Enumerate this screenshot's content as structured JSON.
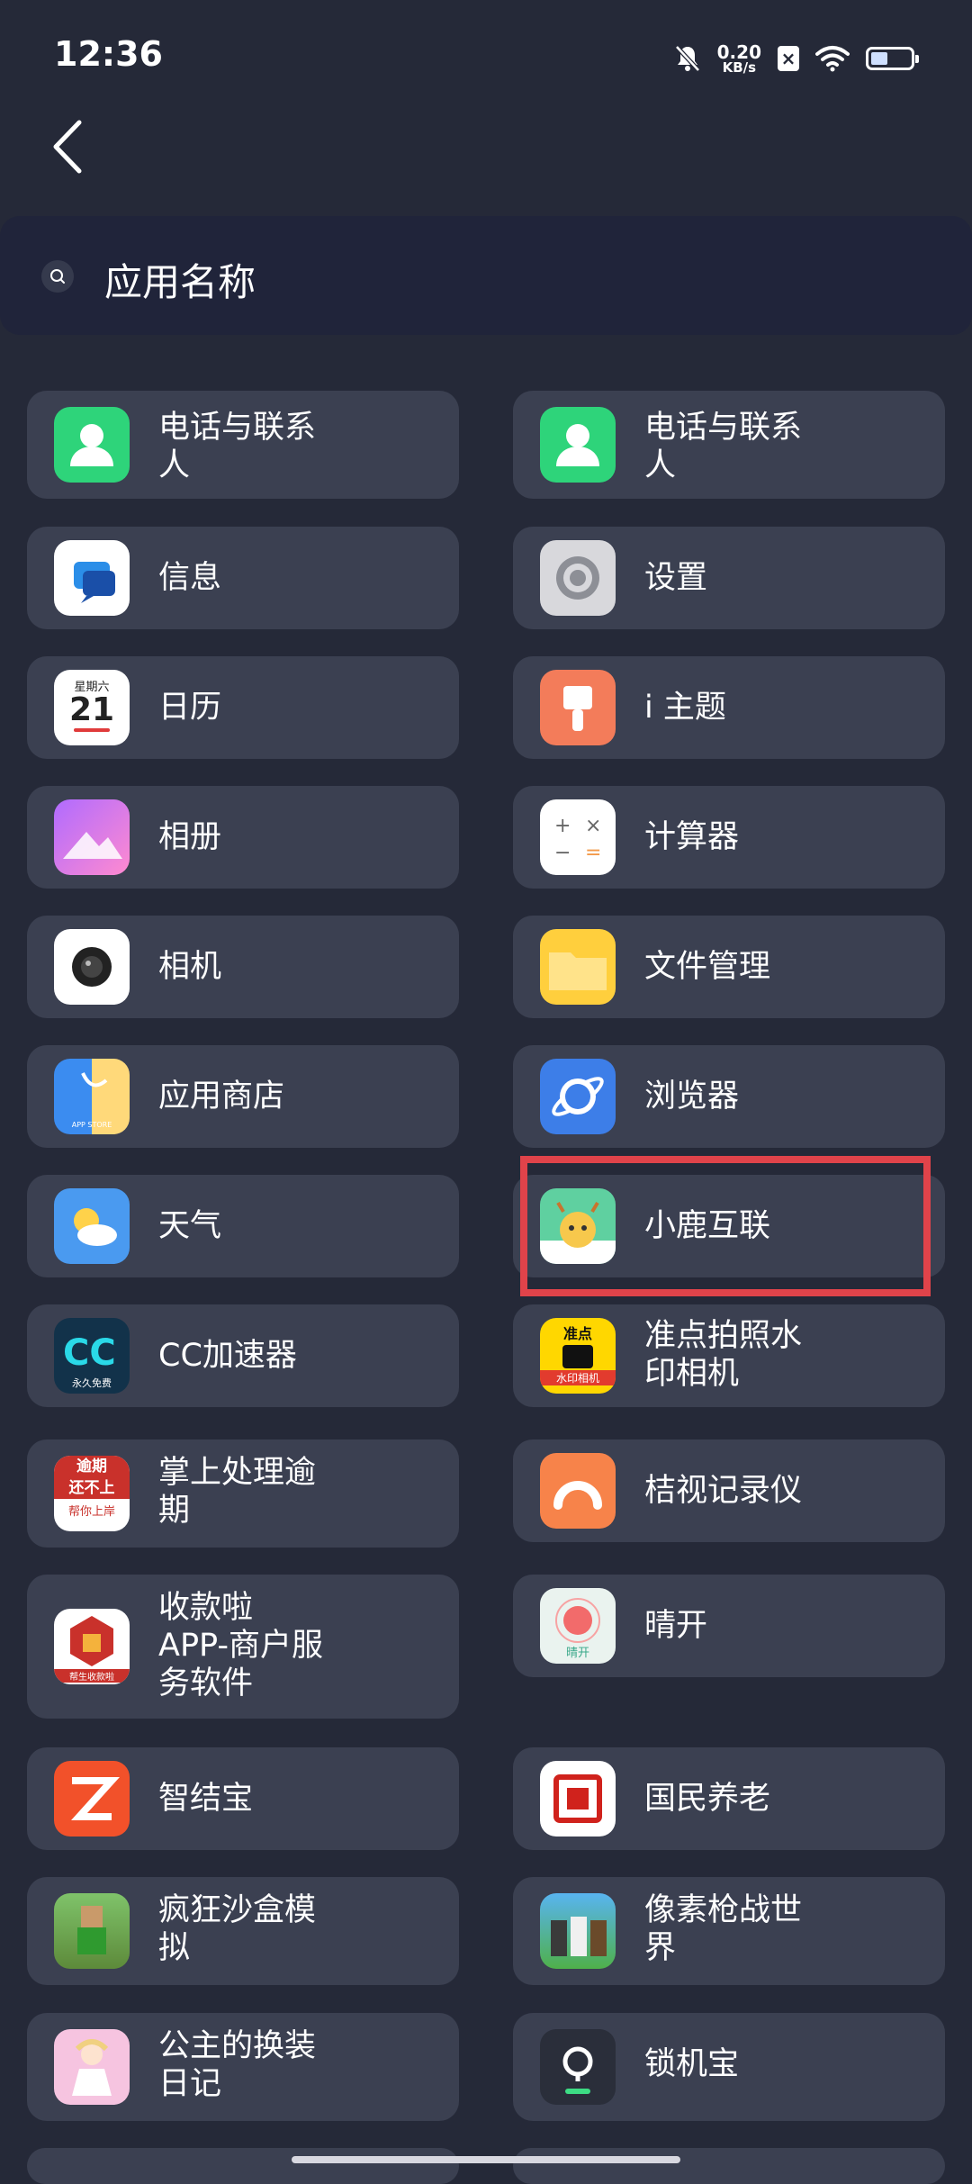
{
  "status": {
    "time": "12:36",
    "net_speed": "0.20",
    "net_unit": "KB/s",
    "icons": [
      "mute-bell-icon",
      "network-speed",
      "close-box-icon",
      "wifi-icon",
      "battery-icon"
    ]
  },
  "nav": {
    "back_icon": "chevron-left-icon"
  },
  "search": {
    "label": "应用名称",
    "icon": "search-icon"
  },
  "apps": [
    {
      "name": "电话与联系\n人",
      "icon": "contacts-icon"
    },
    {
      "name": "电话与联系\n人",
      "icon": "contacts-icon"
    },
    {
      "name": "信息",
      "icon": "messages-icon"
    },
    {
      "name": "设置",
      "icon": "gear-icon"
    },
    {
      "name": "日历",
      "icon": "calendar-icon",
      "icon_text_top": "星期六",
      "icon_text_day": "21"
    },
    {
      "name": "i 主题",
      "icon": "theme-brush-icon"
    },
    {
      "name": "相册",
      "icon": "gallery-icon"
    },
    {
      "name": "计算器",
      "icon": "calculator-icon"
    },
    {
      "name": "相机",
      "icon": "camera-icon"
    },
    {
      "name": "文件管理",
      "icon": "folder-icon"
    },
    {
      "name": "应用商店",
      "icon": "app-store-icon",
      "icon_text": "APP STORE"
    },
    {
      "name": "浏览器",
      "icon": "browser-planet-icon"
    },
    {
      "name": "天气",
      "icon": "weather-icon"
    },
    {
      "name": "小鹿互联",
      "icon": "deer-app-icon"
    },
    {
      "name": "CC加速器",
      "icon": "cc-accelerator-icon",
      "icon_text": "永久免费"
    },
    {
      "name": "准点拍照水\n印相机",
      "icon": "watermark-camera-icon",
      "icon_text_top": "准点",
      "icon_text_bottom": "水印相机"
    },
    {
      "name": "掌上处理逾\n期",
      "icon": "overdue-app-icon",
      "icon_text_a": "逾期",
      "icon_text_b": "还不上",
      "icon_text_c": "帮你上岸"
    },
    {
      "name": "桔视记录仪",
      "icon": "dashcam-icon"
    },
    {
      "name": "收款啦\nAPP-商户服\n务软件",
      "icon": "payment-app-icon",
      "icon_text": "帮生收款啦"
    },
    {
      "name": "晴开",
      "icon": "sun-app-icon",
      "icon_text": "晴开"
    },
    {
      "name": "智结宝",
      "icon": "zjb-app-icon"
    },
    {
      "name": "国民养老",
      "icon": "pension-app-icon"
    },
    {
      "name": "疯狂沙盒模\n拟",
      "icon": "sandbox-game-icon"
    },
    {
      "name": "像素枪战世\n界",
      "icon": "pixel-shooter-icon"
    },
    {
      "name": "公主的换装\n日记",
      "icon": "princess-dressup-icon"
    },
    {
      "name": "锁机宝",
      "icon": "lock-app-icon"
    }
  ]
}
